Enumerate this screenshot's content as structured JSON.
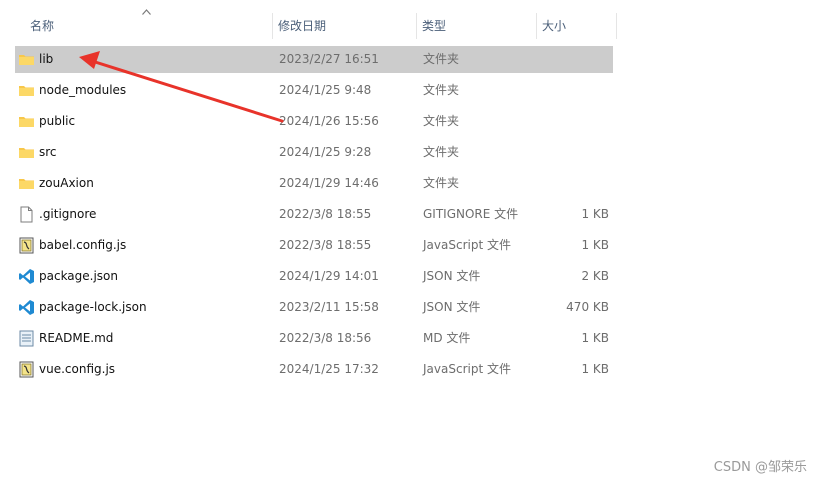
{
  "columns": {
    "name": "名称",
    "date": "修改日期",
    "type": "类型",
    "size": "大小"
  },
  "files": [
    {
      "name": "lib",
      "date": "2023/2/27 16:51",
      "type": "文件夹",
      "size": "",
      "icon": "folder-icon",
      "selected": true
    },
    {
      "name": "node_modules",
      "date": "2024/1/25 9:48",
      "type": "文件夹",
      "size": "",
      "icon": "folder-icon"
    },
    {
      "name": "public",
      "date": "2024/1/26 15:56",
      "type": "文件夹",
      "size": "",
      "icon": "folder-icon"
    },
    {
      "name": "src",
      "date": "2024/1/25 9:28",
      "type": "文件夹",
      "size": "",
      "icon": "folder-icon"
    },
    {
      "name": "zouAxion",
      "date": "2024/1/29 14:46",
      "type": "文件夹",
      "size": "",
      "icon": "folder-icon"
    },
    {
      "name": ".gitignore",
      "date": "2022/3/8 18:55",
      "type": "GITIGNORE 文件",
      "size": "1 KB",
      "icon": "blank-file-icon"
    },
    {
      "name": "babel.config.js",
      "date": "2022/3/8 18:55",
      "type": "JavaScript 文件",
      "size": "1 KB",
      "icon": "js-file-icon"
    },
    {
      "name": "package.json",
      "date": "2024/1/29 14:01",
      "type": "JSON 文件",
      "size": "2 KB",
      "icon": "vscode-file-icon"
    },
    {
      "name": "package-lock.json",
      "date": "2023/2/11 15:58",
      "type": "JSON 文件",
      "size": "470 KB",
      "icon": "vscode-file-icon"
    },
    {
      "name": "README.md",
      "date": "2022/3/8 18:56",
      "type": "MD 文件",
      "size": "1 KB",
      "icon": "text-file-icon"
    },
    {
      "name": "vue.config.js",
      "date": "2024/1/25 17:32",
      "type": "JavaScript 文件",
      "size": "1 KB",
      "icon": "js-file-icon"
    }
  ],
  "watermark": "CSDN @邹荣乐",
  "colors": {
    "folder": "#f8c74a",
    "selection": "#cccccc",
    "arrow": "#e8332a",
    "vscode": "#1f8ad2"
  }
}
